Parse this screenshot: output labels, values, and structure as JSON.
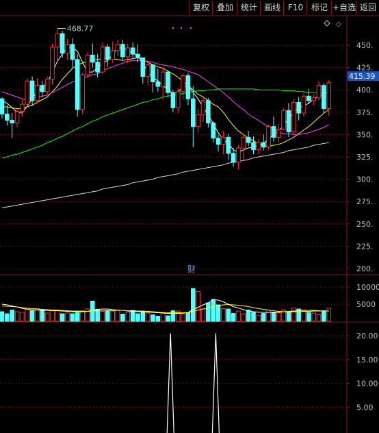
{
  "toolbar": {
    "buttons": [
      "复权",
      "叠加",
      "统计",
      "画线",
      "F10",
      "标记",
      "+自选",
      "返回"
    ]
  },
  "colors": {
    "up": "#ff3232",
    "down": "#54ffff",
    "ma5": "#ffffff",
    "ma10": "#ffff00",
    "ma20": "#ff40ff",
    "ma60": "#00ff00",
    "ma250": "#d8d8d8",
    "grid": "#7a1a1a",
    "axis_text": "#c0c0c0",
    "price_tag_bg": "#1a52c8",
    "marker": "#ff40ff"
  },
  "chart_data": {
    "type": "candlestick",
    "price_panel": {
      "ylim": [
        175,
        475
      ],
      "ticks": [
        450,
        425,
        400,
        375,
        350,
        325,
        300,
        275,
        250,
        225,
        200
      ],
      "tick_labels": [
        "450.",
        "425.",
        "400.",
        "375.",
        "350.",
        "325.",
        "300.",
        "275.",
        "250.",
        "225.",
        "200."
      ],
      "current_price_label": "415.39",
      "current_price": 415.39,
      "high_annotation": "468.77",
      "high_value": 468.77,
      "candles": [
        [
          390,
          392,
          368,
          373
        ],
        [
          373,
          383,
          360,
          366
        ],
        [
          366,
          374,
          346,
          363
        ],
        [
          363,
          378,
          358,
          376
        ],
        [
          376,
          389,
          370,
          384
        ],
        [
          384,
          413,
          380,
          410
        ],
        [
          410,
          415,
          382,
          388
        ],
        [
          388,
          413,
          385,
          405
        ],
        [
          405,
          410,
          392,
          398
        ],
        [
          398,
          415,
          394,
          412
        ],
        [
          412,
          452,
          406,
          448
        ],
        [
          448,
          469,
          431,
          463
        ],
        [
          463,
          466,
          436,
          441
        ],
        [
          441,
          457,
          434,
          451
        ],
        [
          451,
          458,
          425,
          434
        ],
        [
          434,
          440,
          370,
          378
        ],
        [
          378,
          419,
          373,
          417
        ],
        [
          417,
          442,
          414,
          439
        ],
        [
          439,
          452,
          425,
          431
        ],
        [
          431,
          440,
          414,
          420
        ],
        [
          420,
          453,
          418,
          448
        ],
        [
          448,
          451,
          426,
          434
        ],
        [
          434,
          454,
          430,
          444
        ],
        [
          444,
          456,
          438,
          451
        ],
        [
          451,
          456,
          434,
          437
        ],
        [
          437,
          452,
          430,
          447
        ],
        [
          447,
          453,
          436,
          440
        ],
        [
          440,
          451,
          431,
          436
        ],
        [
          436,
          426,
          407,
          415
        ],
        [
          415,
          432,
          405,
          428
        ],
        [
          428,
          429,
          397,
          409
        ],
        [
          409,
          424,
          398,
          404
        ],
        [
          404,
          426,
          389,
          420
        ],
        [
          420,
          422,
          393,
          397
        ],
        [
          397,
          400,
          375,
          380
        ],
        [
          380,
          402,
          374,
          398
        ],
        [
          398,
          418,
          389,
          416
        ],
        [
          416,
          419,
          383,
          390
        ],
        [
          390,
          404,
          336,
          359
        ],
        [
          359,
          379,
          352,
          372
        ],
        [
          372,
          391,
          364,
          388
        ],
        [
          388,
          391,
          358,
          363
        ],
        [
          363,
          365,
          341,
          346
        ],
        [
          346,
          350,
          331,
          339
        ],
        [
          339,
          354,
          328,
          347
        ],
        [
          347,
          351,
          322,
          329
        ],
        [
          329,
          335,
          314,
          319
        ],
        [
          319,
          338,
          311,
          335
        ],
        [
          335,
          351,
          322,
          347
        ],
        [
          347,
          354,
          337,
          341
        ],
        [
          341,
          348,
          328,
          333
        ],
        [
          333,
          345,
          328,
          341
        ],
        [
          341,
          350,
          332,
          336
        ],
        [
          336,
          361,
          333,
          359
        ],
        [
          359,
          370,
          342,
          347
        ],
        [
          347,
          362,
          341,
          356
        ],
        [
          356,
          380,
          355,
          377
        ],
        [
          377,
          385,
          347,
          353
        ],
        [
          353,
          390,
          350,
          386
        ],
        [
          386,
          392,
          366,
          374
        ],
        [
          374,
          396,
          370,
          393
        ],
        [
          393,
          401,
          384,
          388
        ],
        [
          388,
          395,
          383,
          391
        ],
        [
          391,
          410,
          388,
          405
        ],
        [
          405,
          408,
          374,
          379
        ],
        [
          379,
          411,
          371,
          408
        ]
      ],
      "ma_lines": [
        {
          "name": "MA5",
          "color_key": "ma5",
          "values": [
            388,
            385,
            380,
            375,
            374,
            382,
            390,
            398,
            403,
            408,
            420,
            432,
            440,
            447,
            448,
            443,
            431,
            420,
            420,
            425,
            430,
            433,
            440,
            447,
            447,
            444,
            441,
            438,
            430,
            420,
            414,
            410,
            405,
            400,
            396,
            398,
            403,
            405,
            397,
            390,
            380,
            373,
            362,
            352,
            344,
            340,
            333,
            330,
            333,
            335,
            336,
            338,
            340,
            345,
            350,
            354,
            360,
            368,
            375,
            380,
            382,
            385,
            390,
            393,
            395,
            398
          ]
        },
        {
          "name": "MA10",
          "color_key": "ma10",
          "values": [
            381,
            381,
            380,
            379,
            379,
            381,
            383,
            386,
            389,
            392,
            398,
            404,
            412,
            418,
            424,
            428,
            430,
            432,
            433,
            434,
            435,
            436,
            435,
            434,
            433,
            434,
            435,
            436,
            434,
            431,
            428,
            426,
            424,
            421,
            418,
            414,
            410,
            405,
            400,
            395,
            392,
            388,
            384,
            381,
            375,
            367,
            360,
            354,
            350,
            346,
            343,
            340,
            337,
            337,
            338,
            339,
            341,
            344,
            347,
            351,
            355,
            359,
            364,
            369,
            374,
            378
          ]
        },
        {
          "name": "MA20",
          "color_key": "ma20",
          "values": [
            398,
            396,
            394,
            392,
            390,
            390,
            391,
            392,
            393,
            394,
            397,
            400,
            403,
            406,
            409,
            411,
            413,
            415,
            417,
            418,
            421,
            424,
            426,
            428,
            430,
            432,
            433,
            433,
            433,
            432,
            431,
            429,
            428,
            427,
            426,
            424,
            423,
            421,
            419,
            417,
            413,
            409,
            405,
            401,
            397,
            392,
            387,
            382,
            378,
            373,
            369,
            366,
            362,
            359,
            356,
            353,
            351,
            351,
            350,
            350,
            351,
            352,
            354,
            356,
            358,
            361
          ]
        },
        {
          "name": "MA60",
          "color_key": "ma60",
          "values": [
            324,
            325,
            327,
            328,
            330,
            332,
            334,
            336,
            338,
            341,
            343,
            346,
            348,
            351,
            354,
            357,
            359,
            362,
            365,
            367,
            370,
            372,
            374,
            376,
            378,
            380,
            382,
            384,
            386,
            387,
            389,
            390,
            392,
            393,
            394,
            395,
            396,
            397,
            398,
            399,
            399,
            400,
            400,
            401,
            401,
            401,
            401,
            401,
            401,
            401,
            401,
            400,
            400,
            400,
            400,
            400,
            399,
            399,
            399,
            398,
            398,
            397,
            397,
            397,
            396,
            396
          ]
        },
        {
          "name": "MA250",
          "color_key": "ma250",
          "values": [
            268,
            269,
            270,
            271,
            272,
            273,
            274,
            275,
            276,
            277,
            278,
            279,
            280,
            281,
            282,
            283,
            284,
            285,
            286,
            287,
            289,
            290,
            291,
            292,
            293,
            294,
            296,
            297,
            298,
            299,
            300,
            302,
            303,
            304,
            305,
            306,
            308,
            309,
            310,
            311,
            312,
            313,
            314,
            315,
            316,
            318,
            319,
            320,
            321,
            322,
            324,
            325,
            326,
            327,
            328,
            329,
            330,
            332,
            333,
            334,
            335,
            336,
            338,
            339,
            340,
            341
          ]
        }
      ]
    },
    "volume_panel": {
      "label": "财",
      "ylim": [
        0,
        13000
      ],
      "ticks": [
        10000,
        5000
      ],
      "tick_labels": [
        "10000",
        "5000"
      ],
      "values": [
        2800,
        2200,
        3300,
        2800,
        2700,
        3900,
        3100,
        3700,
        3400,
        2400,
        3200,
        3200,
        2200,
        2400,
        2200,
        2500,
        3100,
        3600,
        5900,
        3500,
        2900,
        3200,
        3000,
        3200,
        2100,
        2700,
        3200,
        2200,
        2800,
        2400,
        1900,
        1500,
        2600,
        1600,
        3100,
        3000,
        2200,
        2600,
        9600,
        8700,
        3600,
        5400,
        6400,
        4800,
        3700,
        3600,
        2300,
        3000,
        2200,
        3300,
        2600,
        1800,
        2300,
        3300,
        2700,
        2500,
        3300,
        2600,
        3900,
        3600,
        3300,
        2600,
        2400,
        2100,
        3100,
        3800
      ],
      "ma_lines": [
        {
          "name": "VMA5",
          "color_key": "ma5",
          "values": [
            5000,
            4800,
            4500,
            4200,
            3800,
            3500,
            3400,
            3300,
            3200,
            3200,
            3100,
            3100,
            3000,
            2900,
            2800,
            2800,
            2800,
            2900,
            3200,
            3500,
            3600,
            3600,
            3400,
            3300,
            3200,
            3000,
            2900,
            2800,
            2800,
            2700,
            2600,
            2500,
            2400,
            2300,
            2300,
            2300,
            2400,
            2600,
            3400,
            4100,
            4800,
            5400,
            6300,
            6200,
            5700,
            5000,
            4300,
            3900,
            3400,
            3100,
            2800,
            2700,
            2600,
            2600,
            2600,
            2700,
            2800,
            2900,
            3000,
            3100,
            3200,
            3200,
            3200,
            3100,
            3000,
            3000
          ]
        },
        {
          "name": "VMA10",
          "color_key": "ma10",
          "values": [
            4500,
            4400,
            4300,
            4200,
            4000,
            3800,
            3700,
            3600,
            3500,
            3400,
            3300,
            3300,
            3200,
            3100,
            3000,
            3000,
            2900,
            2900,
            3000,
            3100,
            3200,
            3200,
            3200,
            3200,
            3200,
            3100,
            3100,
            3000,
            3000,
            2900,
            2800,
            2700,
            2600,
            2500,
            2500,
            2500,
            2500,
            2600,
            2900,
            3300,
            3600,
            3900,
            4300,
            4600,
            4800,
            4900,
            4800,
            4700,
            4500,
            4300,
            4000,
            3700,
            3500,
            3300,
            3100,
            2900,
            2800,
            2800,
            2800,
            2800,
            2900,
            2900,
            3000,
            3000,
            3000,
            3000
          ]
        }
      ]
    },
    "indicator_panel": {
      "ylim": [
        0,
        23
      ],
      "ticks": [
        20,
        15,
        10,
        5
      ],
      "tick_labels": [
        "20.00",
        "15.00",
        "10.00",
        "5.00"
      ],
      "values": [
        0,
        0,
        0,
        0,
        0,
        0,
        0,
        0,
        0,
        0,
        0,
        0,
        0,
        0,
        0,
        0,
        0,
        0,
        0,
        0,
        0,
        0,
        0,
        0,
        0,
        0,
        0,
        0,
        0,
        0,
        0,
        0,
        0,
        0,
        20.5,
        0,
        0,
        0,
        0,
        0,
        0,
        0,
        0,
        0,
        0,
        0,
        0,
        0,
        0,
        0,
        0,
        0,
        0,
        0,
        0,
        0,
        0,
        0,
        0,
        0,
        0,
        0,
        0,
        0,
        0,
        0
      ],
      "peaks": [
        {
          "index": 33.5,
          "value": 20.5
        },
        {
          "index": 42.5,
          "value": 20.5
        }
      ]
    }
  }
}
